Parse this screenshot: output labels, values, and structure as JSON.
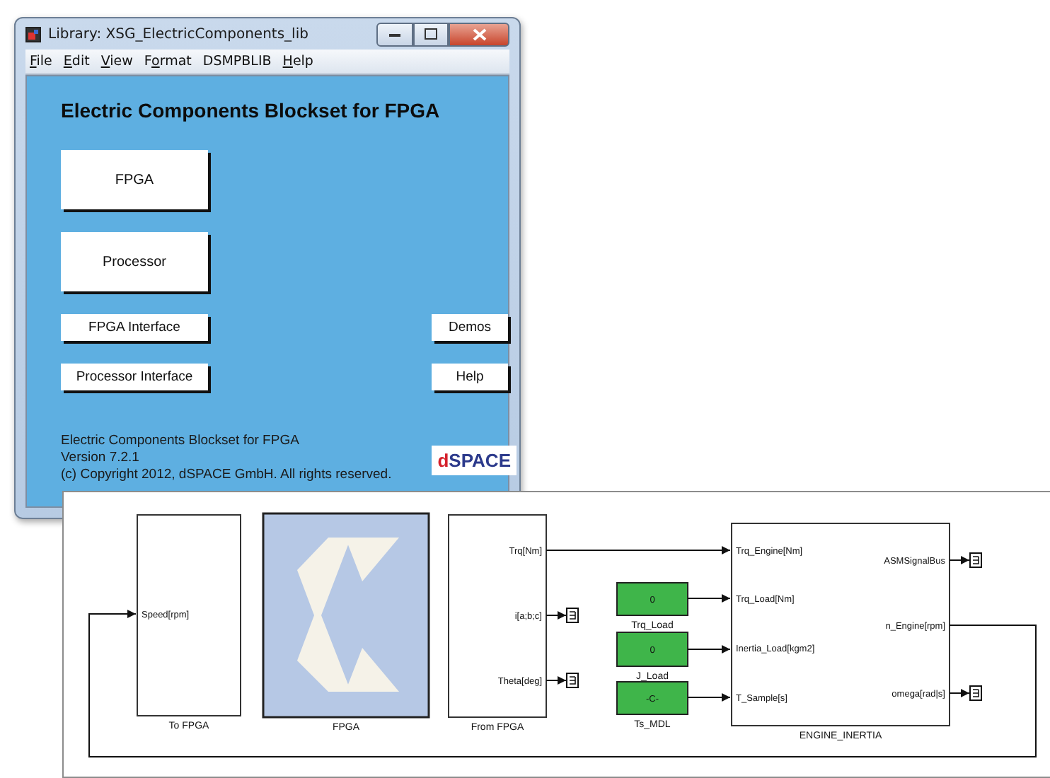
{
  "library_window": {
    "title": "Library: XSG_ElectricComponents_lib",
    "menu": [
      {
        "key": "F",
        "after": "ile"
      },
      {
        "key": "E",
        "after": "dit"
      },
      {
        "key": "V",
        "after": "iew"
      },
      {
        "before": "F",
        "key": "o",
        "after": "rmat"
      },
      {
        "before": "DSMPBLIB"
      },
      {
        "key": "H",
        "after": "elp"
      }
    ],
    "heading": "Electric Components Blockset for FPGA",
    "buttons": [
      {
        "label": "FPGA",
        "kind": "large"
      },
      {
        "label": "Processor",
        "kind": "large"
      },
      {
        "label": "FPGA Interface",
        "kind": "small"
      },
      {
        "label": "Demos",
        "kind": "side"
      },
      {
        "label": "Processor Interface",
        "kind": "small"
      },
      {
        "label": "Help",
        "kind": "side"
      }
    ],
    "footer": [
      "Electric Components Blockset for FPGA",
      "Version 7.2.1",
      "(c) Copyright 2012, dSPACE GmbH. All rights reserved."
    ],
    "logo": {
      "accent": "d",
      "rest": "SPACE"
    }
  },
  "model_window": {
    "blocks": [
      {
        "kind": "subsystem",
        "label": "To FPGA",
        "inputs": [
          "Speed[rpm]"
        ]
      },
      {
        "kind": "fpga",
        "label": "FPGA"
      },
      {
        "kind": "subsystem",
        "label": "From FPGA",
        "outputs": [
          "Trq[Nm]",
          "i[a;b;c]",
          "Theta[deg]"
        ]
      },
      {
        "kind": "constant",
        "label": "Trq_Load",
        "value": "0"
      },
      {
        "kind": "constant",
        "label": "J_Load",
        "value": "0"
      },
      {
        "kind": "constant",
        "label": "Ts_MDL",
        "value": "-C-"
      },
      {
        "kind": "subsystem",
        "label": "ENGINE_INERTIA",
        "inputs": [
          "Trq_Engine[Nm]",
          "Trq_Load[Nm]",
          "Inertia_Load[kgm2]",
          "T_Sample[s]"
        ],
        "outputs": [
          "ASMSignalBus",
          "n_Engine[rpm]",
          "omega[rad|s]"
        ]
      }
    ]
  }
}
